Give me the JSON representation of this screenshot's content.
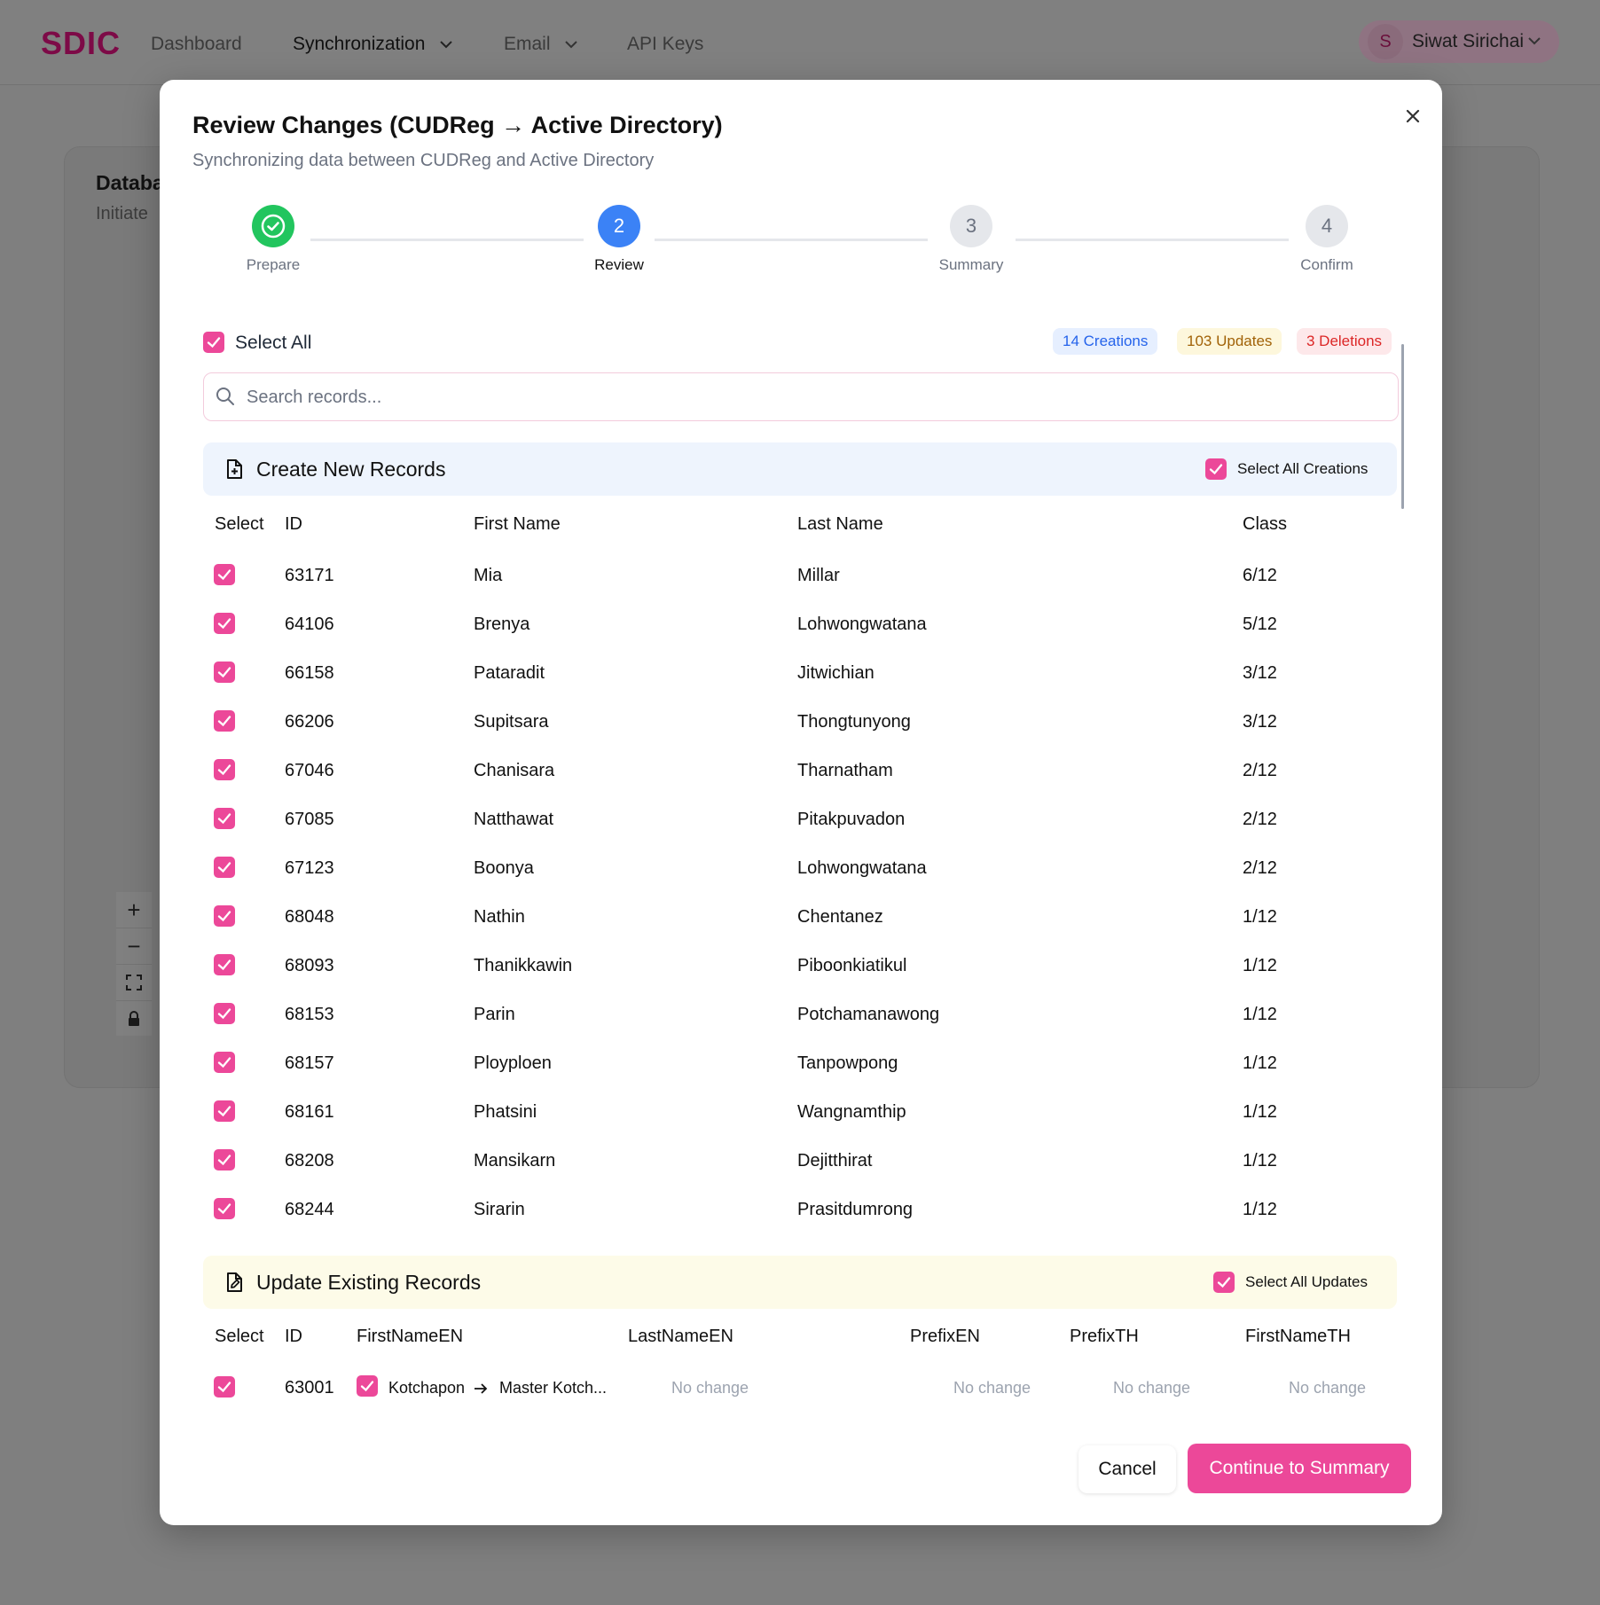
{
  "app": {
    "logo": "SDIC",
    "nav": [
      "Dashboard",
      "Synchronization",
      "Email",
      "API Keys"
    ],
    "user": {
      "initial": "S",
      "name": "Siwat Sirichai"
    },
    "background": {
      "title": "Databa",
      "subtitle": "Initiate"
    }
  },
  "modal": {
    "title": "Review Changes (CUDReg → Active Directory)",
    "subtitle": "Synchronizing data between CUDReg and Active Directory",
    "steps": [
      {
        "num": "1",
        "label": "Prepare",
        "state": "complete"
      },
      {
        "num": "2",
        "label": "Review",
        "state": "active"
      },
      {
        "num": "3",
        "label": "Summary",
        "state": "pending"
      },
      {
        "num": "4",
        "label": "Confirm",
        "state": "pending"
      }
    ],
    "select_all": "Select All",
    "badges": {
      "creations": "14 Creations",
      "updates": "103 Updates",
      "deletions": "3 Deletions"
    },
    "search_placeholder": "Search records...",
    "create_section": {
      "title": "Create New Records",
      "select_all": "Select All Creations",
      "headers": [
        "Select",
        "ID",
        "First Name",
        "Last Name",
        "Class"
      ],
      "rows": [
        {
          "id": "63171",
          "first": "Mia",
          "last": "Millar",
          "class": "6/12"
        },
        {
          "id": "64106",
          "first": "Brenya",
          "last": "Lohwongwatana",
          "class": "5/12"
        },
        {
          "id": "66158",
          "first": "Pataradit",
          "last": "Jitwichian",
          "class": "3/12"
        },
        {
          "id": "66206",
          "first": "Supitsara",
          "last": "Thongtunyong",
          "class": "3/12"
        },
        {
          "id": "67046",
          "first": "Chanisara",
          "last": "Tharnatham",
          "class": "2/12"
        },
        {
          "id": "67085",
          "first": "Natthawat",
          "last": "Pitakpuvadon",
          "class": "2/12"
        },
        {
          "id": "67123",
          "first": "Boonya",
          "last": "Lohwongwatana",
          "class": "2/12"
        },
        {
          "id": "68048",
          "first": "Nathin",
          "last": "Chentanez",
          "class": "1/12"
        },
        {
          "id": "68093",
          "first": "Thanikkawin",
          "last": "Piboonkiatikul",
          "class": "1/12"
        },
        {
          "id": "68153",
          "first": "Parin",
          "last": "Potchamanawong",
          "class": "1/12"
        },
        {
          "id": "68157",
          "first": "Ployploen",
          "last": "Tanpowpong",
          "class": "1/12"
        },
        {
          "id": "68161",
          "first": "Phatsini",
          "last": "Wangnamthip",
          "class": "1/12"
        },
        {
          "id": "68208",
          "first": "Mansikarn",
          "last": "Dejitthirat",
          "class": "1/12"
        },
        {
          "id": "68244",
          "first": "Sirarin",
          "last": "Prasitdumrong",
          "class": "1/12"
        }
      ]
    },
    "update_section": {
      "title": "Update Existing Records",
      "select_all": "Select All Updates",
      "headers": [
        "Select",
        "ID",
        "FirstNameEN",
        "LastNameEN",
        "PrefixEN",
        "PrefixTH",
        "FirstNameTH"
      ],
      "rows": [
        {
          "id": "63001",
          "first_old": "Kotchapon",
          "first_new": "Master Kotch...",
          "last": "No change",
          "prefix_en": "No change",
          "prefix_th": "No change",
          "first_th": "No change"
        }
      ]
    },
    "cancel": "Cancel",
    "continue": "Continue to Summary"
  },
  "colors": {
    "accent": "#ec4899",
    "complete": "#22c55e",
    "active": "#3b82f6"
  }
}
